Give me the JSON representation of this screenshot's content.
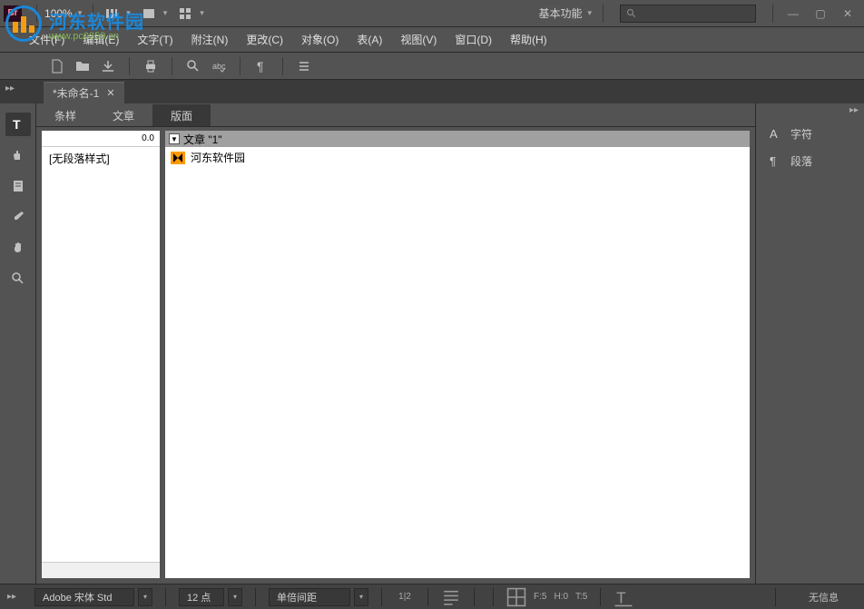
{
  "app": {
    "icon_text": "Br"
  },
  "topbar": {
    "zoom": "100%",
    "workspace": "基本功能"
  },
  "menu": {
    "file": "文件(F)",
    "edit": "编辑(E)",
    "type": "文字(T)",
    "notes": "附注(N)",
    "change": "更改(C)",
    "object": "对象(O)",
    "table": "表(A)",
    "view": "视图(V)",
    "window": "窗口(D)",
    "help": "帮助(H)"
  },
  "doc": {
    "tab_title": "*未命名-1"
  },
  "panels": {
    "tab1": "条样",
    "tab2": "文章",
    "tab3": "版面"
  },
  "sidebar_left": {
    "header_num": "0.0",
    "no_style": "[无段落样式]"
  },
  "article": {
    "header": "文章 \"1\"",
    "item1": "河东软件园"
  },
  "right": {
    "char": "字符",
    "para": "段落"
  },
  "status": {
    "font": "Adobe 宋体 Std",
    "size": "12 点",
    "spacing": "单倍间距",
    "frac": "1",
    "frac_d": "2",
    "f": "F:5",
    "h": "H:0",
    "t": "T:5",
    "info": "无信息"
  },
  "watermark": {
    "cn": "河东软件园",
    "url": "www.pc0359.cn"
  }
}
